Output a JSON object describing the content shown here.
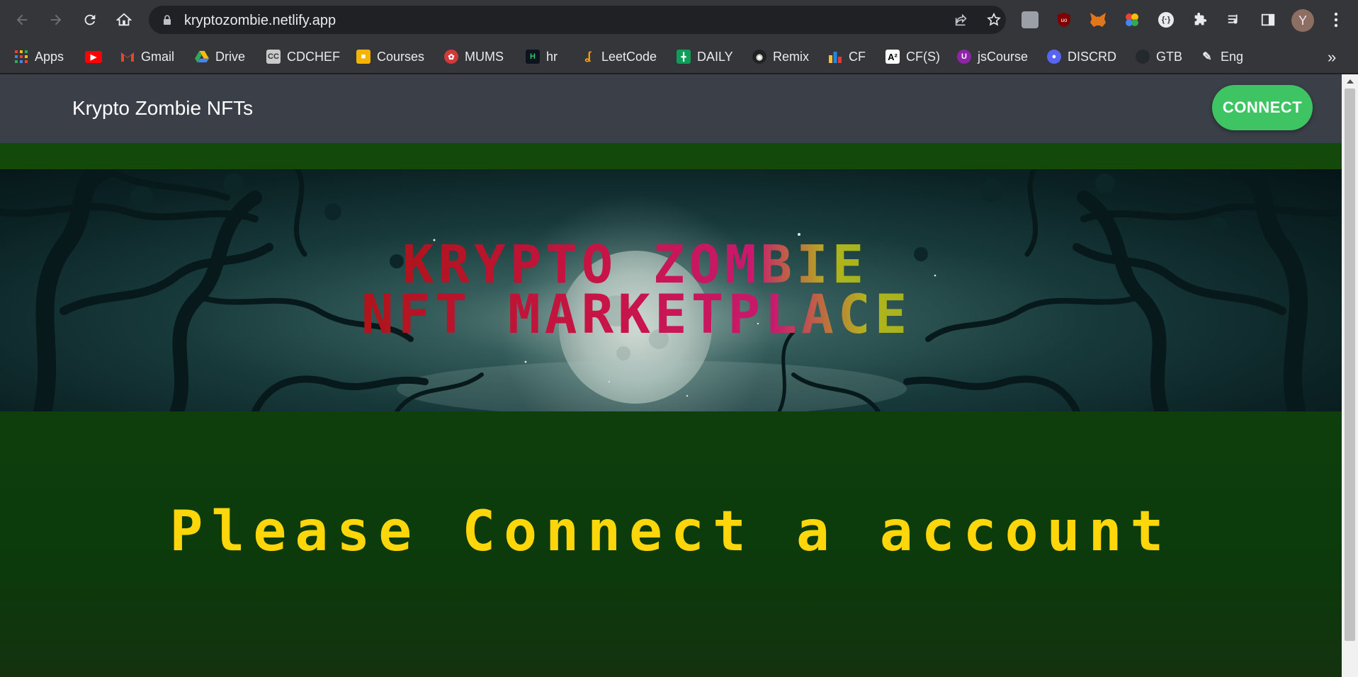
{
  "browser": {
    "url": "kryptozombie.netlify.app",
    "avatar_letter": "Y",
    "icons": {
      "back": "arrow-left-icon",
      "forward": "arrow-right-icon",
      "reload": "reload-icon",
      "home": "home-icon",
      "lock": "lock-icon",
      "share": "share-icon",
      "star": "star-icon"
    },
    "extensions": [
      "tab-search-ext",
      "ublock-ext",
      "metamask-ext",
      "color-picker-ext",
      "code-ext",
      "puzzle-icon",
      "media-icon",
      "side-panel-icon"
    ]
  },
  "bookmarks": [
    {
      "label": "Apps",
      "icon": "apps-grid-icon"
    },
    {
      "label": "",
      "icon": "youtube-icon"
    },
    {
      "label": "Gmail",
      "icon": "gmail-icon"
    },
    {
      "label": "Drive",
      "icon": "drive-icon"
    },
    {
      "label": "CDCHEF",
      "icon": "codechef-icon"
    },
    {
      "label": "Courses",
      "icon": "courses-icon"
    },
    {
      "label": "MUMS",
      "icon": "mums-icon"
    },
    {
      "label": "hr",
      "icon": "hackerrank-icon"
    },
    {
      "label": "LeetCode",
      "icon": "leetcode-icon"
    },
    {
      "label": "DAILY",
      "icon": "daily-icon"
    },
    {
      "label": "Remix",
      "icon": "remix-icon"
    },
    {
      "label": "CF",
      "icon": "codeforces-icon"
    },
    {
      "label": "CF(S)",
      "icon": "a2-icon"
    },
    {
      "label": "jsCourse",
      "icon": "jscourse-icon"
    },
    {
      "label": "DISCRD",
      "icon": "discord-icon"
    },
    {
      "label": "GTB",
      "icon": "github-icon"
    },
    {
      "label": "Eng",
      "icon": "pen-icon"
    }
  ],
  "bookmarks_more": "»",
  "page": {
    "brand": "Krypto Zombie NFTs",
    "connect_label": "CONNECT",
    "banner_line1": "KRYPTO ZOMBIE",
    "banner_line2": "NFT MARKETPLACE",
    "message": "Please Connect a account"
  },
  "colors": {
    "navbar": "#3a3f48",
    "connect_button": "#3fc463",
    "background_green": "#103c0c",
    "message_yellow": "#ffd60a",
    "title_red": "#c81448"
  }
}
